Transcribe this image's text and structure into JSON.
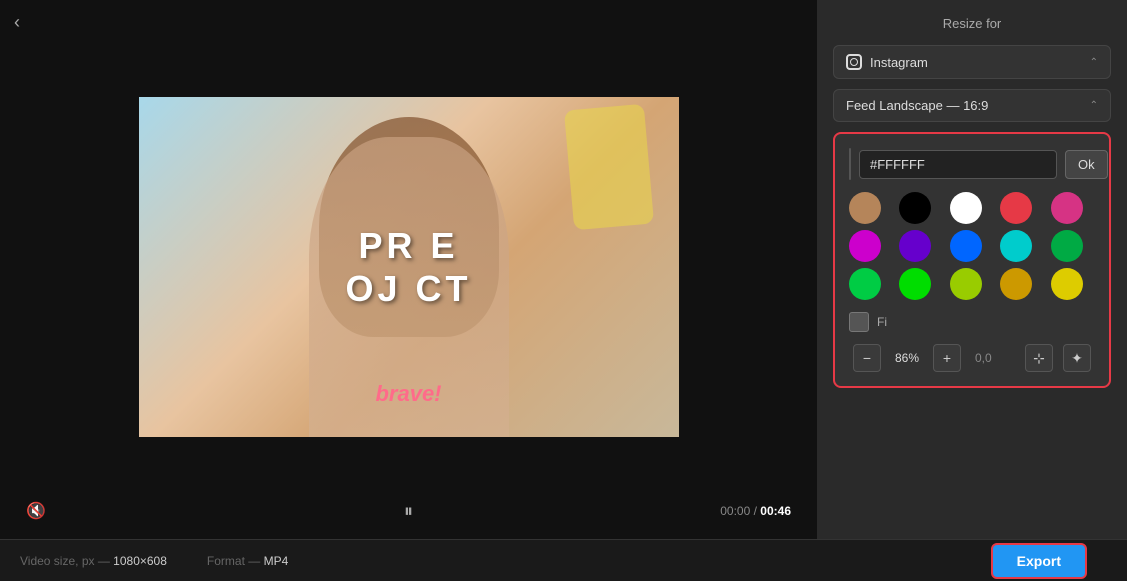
{
  "header": {
    "back_label": "‹"
  },
  "video": {
    "text_overlay_line1": "PR   E",
    "text_overlay_line2": "OJ  CT",
    "bottom_text": "brave!",
    "time_current": "00:00",
    "time_sep": "/",
    "time_total": "00:46"
  },
  "right_panel": {
    "resize_label": "Resize for",
    "platform_dropdown": {
      "label": "Instagram",
      "arrow": "⌃"
    },
    "format_dropdown": {
      "label": "Feed Landscape — 16:9",
      "arrow": "⌃"
    },
    "color_picker": {
      "hex_value": "#FFFFFF",
      "ok_label": "Ok",
      "swatches": [
        {
          "color": "#b5855a",
          "name": "skin-swatch"
        },
        {
          "color": "#000000",
          "name": "black-swatch"
        },
        {
          "color": "#ffffff",
          "name": "white-swatch"
        },
        {
          "color": "#e63946",
          "name": "red-swatch"
        },
        {
          "color": "#d63384",
          "name": "pink-swatch"
        },
        {
          "color": "#cc00cc",
          "name": "magenta-swatch"
        },
        {
          "color": "#6600cc",
          "name": "purple-swatch"
        },
        {
          "color": "#0066ff",
          "name": "blue-swatch"
        },
        {
          "color": "#00cccc",
          "name": "cyan-swatch"
        },
        {
          "color": "#00aa44",
          "name": "teal-swatch"
        },
        {
          "color": "#00cc44",
          "name": "green1-swatch"
        },
        {
          "color": "#00dd00",
          "name": "green2-swatch"
        },
        {
          "color": "#99cc00",
          "name": "lime-swatch"
        },
        {
          "color": "#cc9900",
          "name": "gold-swatch"
        },
        {
          "color": "#ddcc00",
          "name": "yellow-swatch"
        }
      ],
      "fill_label": "Fi"
    },
    "toolbar": {
      "zoom_out": "−",
      "zoom_pct": "86%",
      "zoom_in": "+",
      "coords": "0,0",
      "move_icon": "✦",
      "paint_icon": "✦"
    }
  },
  "status_bar": {
    "video_size_label": "Video size, px —",
    "video_size_value": "1080×608",
    "format_label": "Format —",
    "format_value": "MP4",
    "export_label": "Export"
  }
}
